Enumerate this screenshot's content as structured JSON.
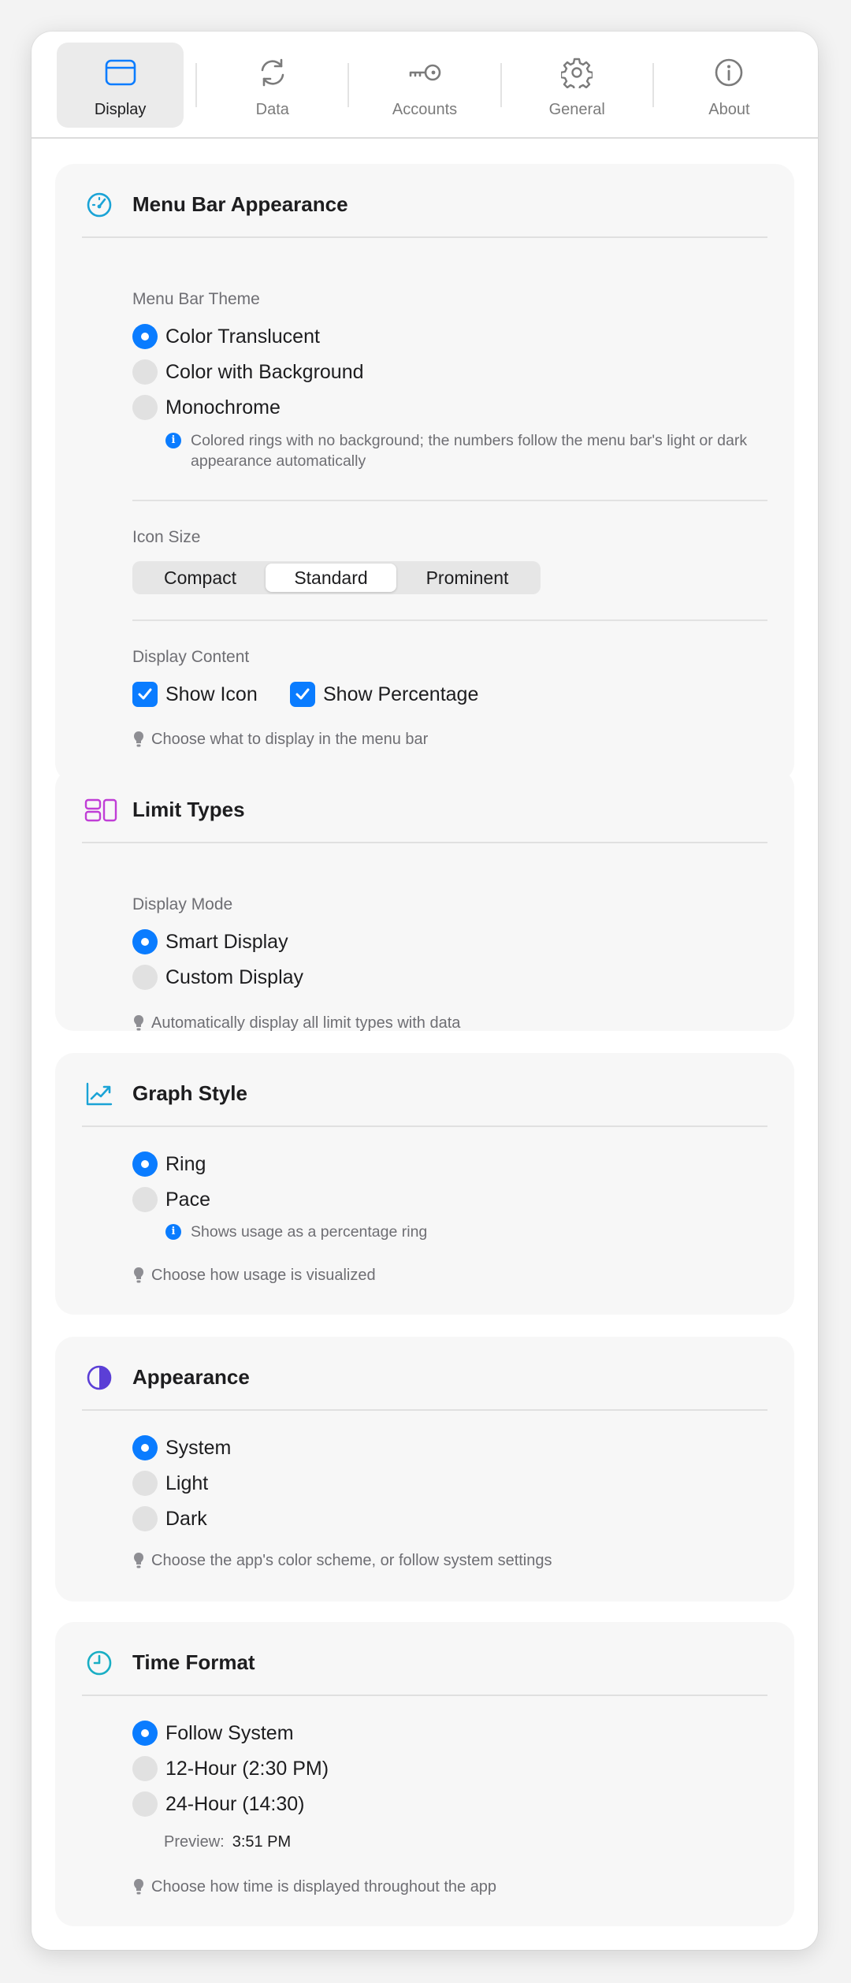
{
  "toolbar": {
    "tabs": [
      {
        "label": "Display",
        "icon": "window-icon",
        "active": true
      },
      {
        "label": "Data",
        "icon": "refresh-icon",
        "active": false
      },
      {
        "label": "Accounts",
        "icon": "key-icon",
        "active": false
      },
      {
        "label": "General",
        "icon": "gear-icon",
        "active": false
      },
      {
        "label": "About",
        "icon": "info-circle-icon",
        "active": false
      }
    ]
  },
  "menu_bar": {
    "title": "Menu Bar Appearance",
    "icon": "gauge-icon",
    "theme_label": "Menu Bar Theme",
    "themes": [
      {
        "label": "Color Translucent",
        "selected": true
      },
      {
        "label": "Color with Background",
        "selected": false
      },
      {
        "label": "Monochrome",
        "selected": false
      }
    ],
    "theme_info": "Colored rings with no background; the numbers follow the menu bar's light or dark appearance automatically",
    "icon_size_label": "Icon Size",
    "icon_sizes": [
      {
        "label": "Compact",
        "selected": false
      },
      {
        "label": "Standard",
        "selected": true
      },
      {
        "label": "Prominent",
        "selected": false
      }
    ],
    "content_label": "Display Content",
    "show_icon": {
      "label": "Show Icon",
      "checked": true
    },
    "show_percentage": {
      "label": "Show Percentage",
      "checked": true
    },
    "hint": "Choose what to display in the menu bar"
  },
  "limit_types": {
    "title": "Limit Types",
    "icon": "layout-icon",
    "mode_label": "Display Mode",
    "modes": [
      {
        "label": "Smart Display",
        "selected": true
      },
      {
        "label": "Custom Display",
        "selected": false
      }
    ],
    "hint": "Automatically display all limit types with data"
  },
  "graph_style": {
    "title": "Graph Style",
    "icon": "chart-line-icon",
    "options": [
      {
        "label": "Ring",
        "selected": true
      },
      {
        "label": "Pace",
        "selected": false
      }
    ],
    "info": "Shows usage as a percentage ring",
    "hint": "Choose how usage is visualized"
  },
  "appearance": {
    "title": "Appearance",
    "icon": "half-circle-icon",
    "options": [
      {
        "label": "System",
        "selected": true
      },
      {
        "label": "Light",
        "selected": false
      },
      {
        "label": "Dark",
        "selected": false
      }
    ],
    "hint": "Choose the app's color scheme, or follow system settings"
  },
  "time_format": {
    "title": "Time Format",
    "icon": "clock-icon",
    "options": [
      {
        "label": "Follow System",
        "selected": true
      },
      {
        "label": "12-Hour (2:30 PM)",
        "selected": false
      },
      {
        "label": "24-Hour (14:30)",
        "selected": false
      }
    ],
    "preview_label": "Preview:",
    "preview_value": "3:51 PM",
    "hint": "Choose how time is displayed throughout the app"
  },
  "colors": {
    "accent": "#0a7cff",
    "menu_bar_icon": "#1aa3d6",
    "limit_types_icon": "#c03ed6",
    "graph_icon": "#1aa3d6",
    "appearance_icon": "#5b3fd6",
    "clock_icon": "#19aec4"
  }
}
